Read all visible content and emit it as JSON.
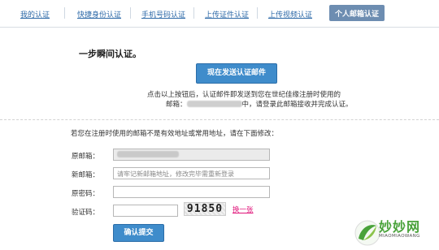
{
  "tabs": [
    {
      "label": "我的认证"
    },
    {
      "label": "快捷身份认证"
    },
    {
      "label": "手机号码认证"
    },
    {
      "label": "上传证件认证"
    },
    {
      "label": "上传视频认证"
    },
    {
      "label": "个人邮箱认证",
      "active": true
    }
  ],
  "main": {
    "heading": "一步瞬间认证。",
    "send_button": "现在发送认证邮件",
    "info_line1": "点击以上按钮后，认证邮件即发送到您在世纪佳缘注册时使用的",
    "info_prefix": "邮箱：",
    "info_suffix": "中，请登录此邮箱接收并完成认证。"
  },
  "form": {
    "prompt": "若您在注册时使用的邮箱不是有效地址或常用地址，请在下面修改：",
    "original_email_label": "原邮箱：",
    "original_email_value_suffix": "@",
    "new_email_label": "新邮箱：",
    "new_email_placeholder": "请牢记新邮箱地址，修改完毕需重新登录",
    "password_label": "原密码：",
    "captcha_label": "验证码：",
    "captcha_text": "91850",
    "refresh_link": "换一张",
    "submit_button": "确认提交"
  },
  "watermark": {
    "name": "妙妙网",
    "sub": "MIAOMIAOWANG"
  },
  "colors": {
    "accent": "#3f8ccb",
    "active_tab": "#6d8db1",
    "link": "#2e6aa8",
    "refresh": "#e0157a",
    "logo_green": "#49a23a"
  }
}
